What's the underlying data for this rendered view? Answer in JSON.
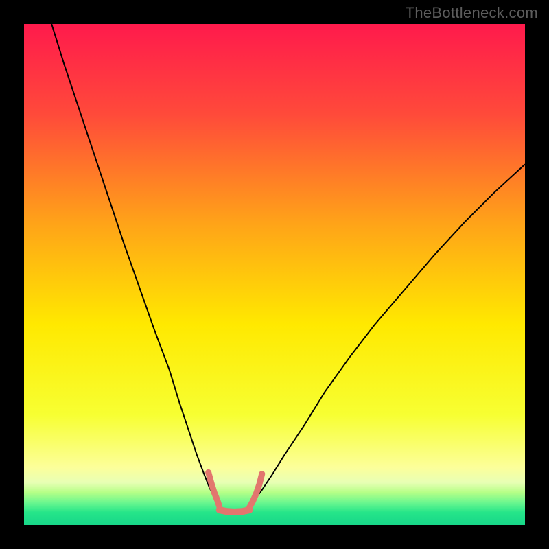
{
  "credit_text": "TheBottleneck.com",
  "chart_data": {
    "type": "line",
    "title": "",
    "xlabel": "",
    "ylabel": "",
    "xlim": [
      0,
      100
    ],
    "ylim": [
      0,
      100
    ],
    "grid": false,
    "legend": false,
    "background_gradient": {
      "stops": [
        {
          "offset": 0.0,
          "color": "#ff1a4c"
        },
        {
          "offset": 0.18,
          "color": "#ff4a3a"
        },
        {
          "offset": 0.4,
          "color": "#ffa418"
        },
        {
          "offset": 0.6,
          "color": "#ffe900"
        },
        {
          "offset": 0.78,
          "color": "#f7ff32"
        },
        {
          "offset": 0.885,
          "color": "#fcff9a"
        },
        {
          "offset": 0.915,
          "color": "#e8ffb5"
        },
        {
          "offset": 0.935,
          "color": "#b6ff87"
        },
        {
          "offset": 0.955,
          "color": "#6cf78f"
        },
        {
          "offset": 0.975,
          "color": "#25e589"
        },
        {
          "offset": 1.0,
          "color": "#18d789"
        }
      ]
    },
    "series": [
      {
        "name": "left-branch",
        "color": "#000000",
        "width": 2,
        "x": [
          5.5,
          8,
          11,
          14,
          17,
          20,
          23,
          26,
          29,
          31,
          33,
          34.5,
          36,
          37,
          38,
          38.7
        ],
        "y": [
          100,
          92,
          83,
          74,
          65,
          56,
          47.5,
          39,
          31,
          24.5,
          18.5,
          14,
          10,
          7.5,
          5.5,
          4.0
        ]
      },
      {
        "name": "right-branch",
        "color": "#000000",
        "width": 2,
        "x": [
          45,
          46,
          47.5,
          49.5,
          52,
          56,
          60,
          65,
          70,
          76,
          82,
          88,
          94,
          100
        ],
        "y": [
          3.8,
          5.0,
          7.0,
          10.0,
          14.0,
          20.0,
          26.5,
          33.5,
          40.0,
          47.0,
          54.0,
          60.5,
          66.5,
          72.0
        ]
      },
      {
        "name": "optimal-marker-left",
        "color": "#e2766e",
        "width": 9,
        "cap": "round",
        "x": [
          36.8,
          37.4,
          38.0,
          38.6,
          39.0
        ],
        "y": [
          10.5,
          8.3,
          6.4,
          4.9,
          3.7
        ]
      },
      {
        "name": "optimal-marker-bottom",
        "color": "#e2766e",
        "width": 10,
        "cap": "round",
        "x": [
          39.0,
          40.5,
          42.0,
          43.5,
          45.0
        ],
        "y": [
          3.0,
          2.7,
          2.6,
          2.7,
          3.0
        ]
      },
      {
        "name": "optimal-marker-right",
        "color": "#e2766e",
        "width": 9,
        "cap": "round",
        "x": [
          45.0,
          45.7,
          46.4,
          47.0,
          47.5
        ],
        "y": [
          3.5,
          4.8,
          6.4,
          8.2,
          10.2
        ]
      }
    ]
  }
}
